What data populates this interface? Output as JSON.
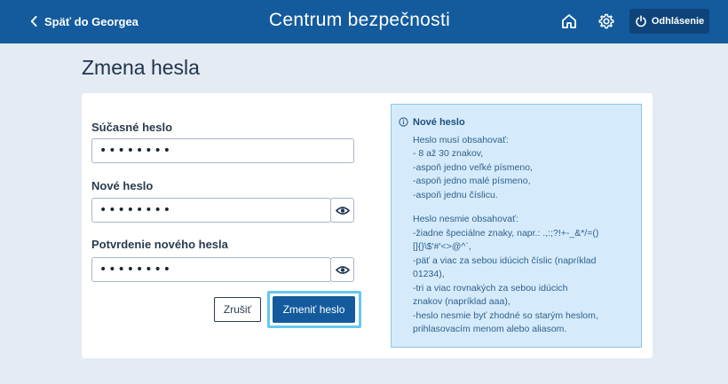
{
  "header": {
    "back_label": "Späť do Georgea",
    "title": "Centrum bezpečnosti",
    "logout_label": "Odhlásenie"
  },
  "page": {
    "title": "Zmena hesla"
  },
  "form": {
    "current_label": "Súčasné heslo",
    "current_value": "••••••••",
    "new_label": "Nové heslo",
    "new_value": "••••••••",
    "confirm_label": "Potvrdenie nového hesla",
    "confirm_value": "••••••••",
    "cancel_label": "Zrušiť",
    "submit_label": "Zmeniť heslo"
  },
  "info": {
    "title": "Nové heslo",
    "must_lines": [
      "Heslo musí obsahovať:",
      "- 8 až 30 znakov,",
      "-aspoň jedno veľké písmeno,",
      "-aspoň jedno malé písmeno,",
      "-aspoň jednu číslicu."
    ],
    "must_not_lines": [
      "Heslo nesmie obsahovať:",
      "-žiadne špeciálne znaky, napr.: .,:;?!+-_&*/=()",
      "[]{}\\$'#'<>@^`,",
      "-päť a viac za sebou idúcich číslic (napríklad",
      "01234),",
      "-tri a viac rovnakých za sebou idúcich",
      "znakov (napríklad aaa),",
      "-heslo nesmie byť zhodné so starým heslom,",
      "prihlasovacím menom alebo aliasom."
    ]
  },
  "colors": {
    "header_bg": "#135b9d",
    "primary_button": "#135b9d",
    "focus_ring": "#66c7ef",
    "info_bg": "#d5ebfb"
  },
  "icons": [
    "chevron-left-icon",
    "home-icon",
    "gear-icon",
    "power-icon",
    "eye-icon",
    "info-icon"
  ]
}
